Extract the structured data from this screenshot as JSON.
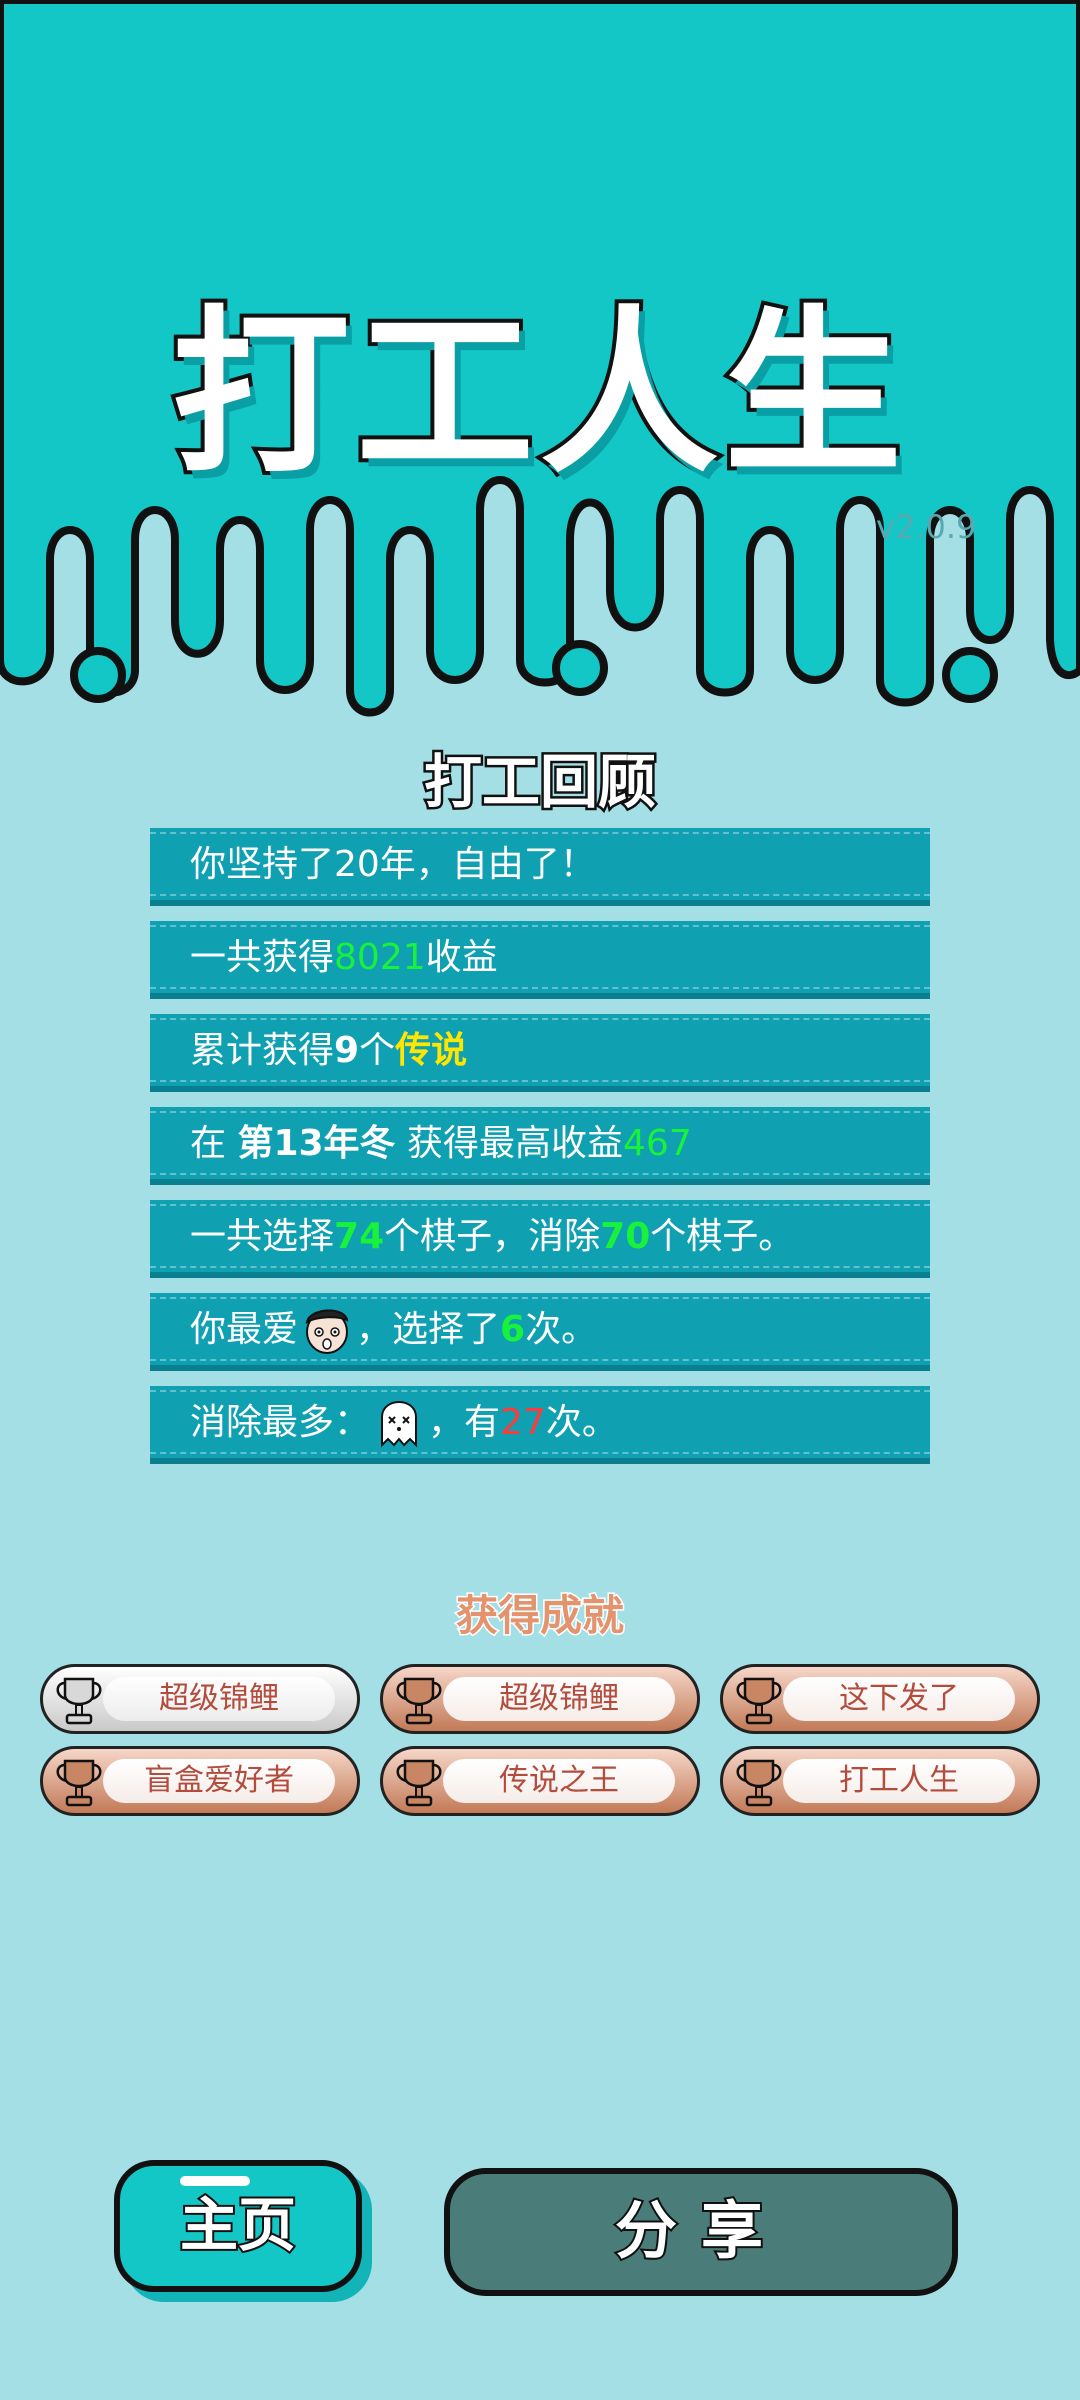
{
  "header": {
    "title": "打工人生",
    "version": "v2.0.9"
  },
  "review": {
    "title": "打工回顾",
    "line1": {
      "text": "你坚持了20年，自由了！"
    },
    "line2": {
      "pre": "一共获得",
      "value": "8021",
      "post": "收益"
    },
    "line3": {
      "pre": "累计获得",
      "count": "9",
      "mid": "个",
      "tag": "传说"
    },
    "line4": {
      "pre": "在 ",
      "period": "第13年冬",
      "mid": " 获得最高收益",
      "value": "467"
    },
    "line5": {
      "pre": "一共选择",
      "chosen": "74",
      "mid": "个棋子，消除",
      "removed": "70",
      "post": "个棋子。"
    },
    "line6": {
      "pre": "你最爱",
      "icon": "face-icon",
      "mid": "，选择了",
      "times": "6",
      "post": "次。"
    },
    "line7": {
      "pre": "消除最多：",
      "icon": "ghost-icon",
      "mid": "，有",
      "times": "27",
      "post": "次。"
    }
  },
  "achievements": {
    "title": "获得成就",
    "items": [
      {
        "label": "超级锦鲤",
        "tier": "silver",
        "icon": "trophy-icon"
      },
      {
        "label": "超级锦鲤",
        "tier": "bronze",
        "icon": "trophy-icon"
      },
      {
        "label": "这下发了",
        "tier": "bronze",
        "icon": "trophy-icon"
      },
      {
        "label": "盲盒爱好者",
        "tier": "bronze",
        "icon": "trophy-icon"
      },
      {
        "label": "传说之王",
        "tier": "bronze",
        "icon": "trophy-icon"
      },
      {
        "label": "打工人生",
        "tier": "bronze",
        "icon": "trophy-icon"
      }
    ]
  },
  "buttons": {
    "home": "主页",
    "share": "分享"
  },
  "colors": {
    "top_bg": "#14c7c7",
    "body_bg": "#a4dfe6",
    "row_bg": "#0fa0b2",
    "highlight_green": "#19f23a",
    "highlight_yellow": "#ffe600",
    "highlight_red": "#ff3a3a",
    "share_btn": "#4a7d7a"
  }
}
